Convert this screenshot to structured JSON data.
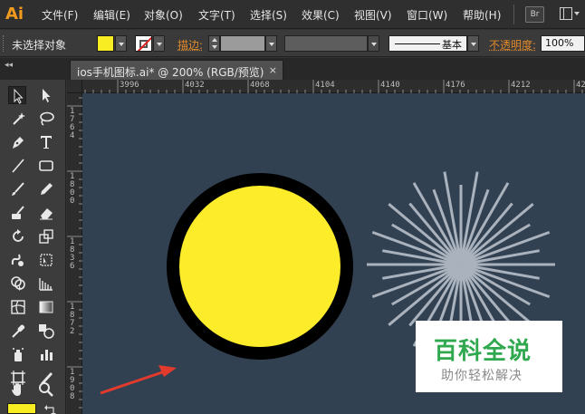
{
  "app": {
    "logo_text": "Ai",
    "bridge_label": "Br"
  },
  "menubar": {
    "items": [
      "文件(F)",
      "编辑(E)",
      "对象(O)",
      "文字(T)",
      "选择(S)",
      "效果(C)",
      "视图(V)",
      "窗口(W)",
      "帮助(H)"
    ]
  },
  "control_bar": {
    "selection_status": "未选择对象",
    "fill_color": "#f8ec22",
    "stroke_label": "描边:",
    "brush_definition": "基本",
    "opacity_label": "不透明度:",
    "opacity_value": "100%"
  },
  "document_tab": {
    "title": "ios手机图标.ai* @ 200% (RGB/预览)",
    "close_glyph": "×"
  },
  "rulers": {
    "horizontal_labels": [
      "3996",
      "4032",
      "4068",
      "4104",
      "4140",
      "4176",
      "4212",
      "42"
    ],
    "vertical_labels": [
      "1764",
      "1800",
      "1836",
      "1872",
      "1908"
    ]
  },
  "artwork": {
    "canvas_color": "#324152",
    "circle_fill": "#fdec2a",
    "circle_stroke": "#000000",
    "ray_color": "#a9b2bd"
  },
  "toolbox": {
    "tools": [
      "selection-tool",
      "direct-selection-tool",
      "magic-wand-tool",
      "lasso-tool",
      "pen-tool",
      "type-tool",
      "line-tool",
      "rectangle-tool",
      "paintbrush-tool",
      "pencil-tool",
      "blob-brush-tool",
      "eraser-tool",
      "rotate-tool",
      "scale-tool",
      "warp-tool",
      "free-transform-tool",
      "shape-builder-tool",
      "perspective-grid-tool",
      "mesh-tool",
      "gradient-tool",
      "eyedropper-tool",
      "blend-tool",
      "symbol-sprayer-tool",
      "column-graph-tool",
      "artboard-tool",
      "slice-tool",
      "hand-tool",
      "zoom-tool"
    ],
    "fill_color": "#f8ec22"
  },
  "watermark": {
    "title": "百科全说",
    "subtitle": "助你轻松解决"
  }
}
